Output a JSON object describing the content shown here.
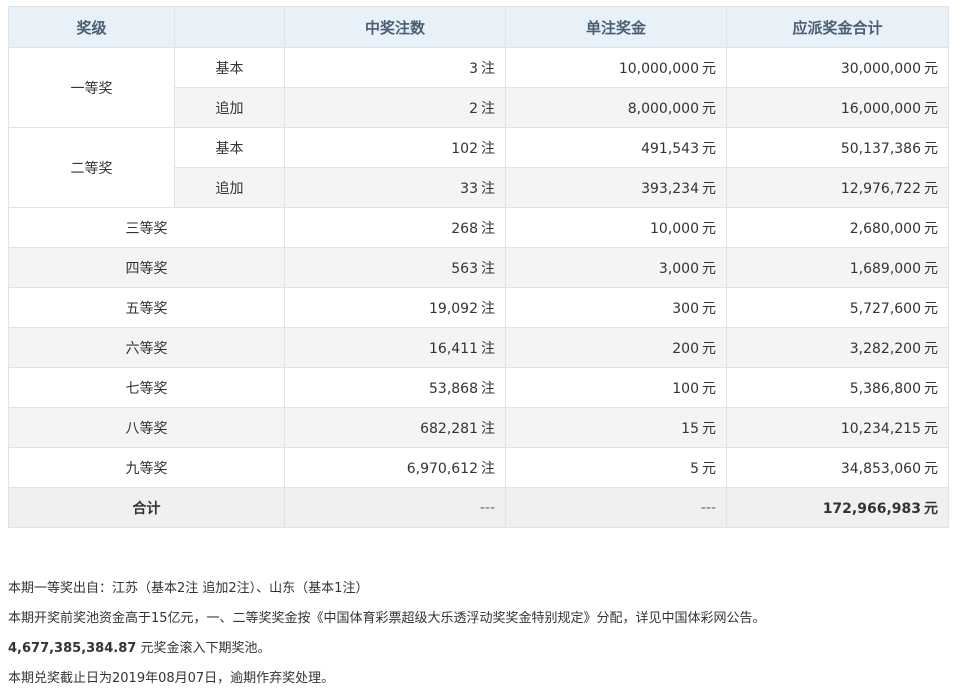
{
  "header": {
    "level": "奖级",
    "count": "中奖注数",
    "unit_prize": "单注奖金",
    "total": "应派奖金合计"
  },
  "units": {
    "zhu": "注",
    "yuan": "元"
  },
  "first": {
    "label": "一等奖",
    "basic": {
      "sub": "基本",
      "count": "3",
      "unit_prize": "10,000,000",
      "total": "30,000,000"
    },
    "extra": {
      "sub": "追加",
      "count": "2",
      "unit_prize": "8,000,000",
      "total": "16,000,000"
    }
  },
  "second": {
    "label": "二等奖",
    "basic": {
      "sub": "基本",
      "count": "102",
      "unit_prize": "491,543",
      "total": "50,137,386"
    },
    "extra": {
      "sub": "追加",
      "count": "33",
      "unit_prize": "393,234",
      "total": "12,976,722"
    }
  },
  "rows": [
    {
      "label": "三等奖",
      "count": "268",
      "unit_prize": "10,000",
      "total": "2,680,000"
    },
    {
      "label": "四等奖",
      "count": "563",
      "unit_prize": "3,000",
      "total": "1,689,000"
    },
    {
      "label": "五等奖",
      "count": "19,092",
      "unit_prize": "300",
      "total": "5,727,600"
    },
    {
      "label": "六等奖",
      "count": "16,411",
      "unit_prize": "200",
      "total": "3,282,200"
    },
    {
      "label": "七等奖",
      "count": "53,868",
      "unit_prize": "100",
      "total": "5,386,800"
    },
    {
      "label": "八等奖",
      "count": "682,281",
      "unit_prize": "15",
      "total": "10,234,215"
    },
    {
      "label": "九等奖",
      "count": "6,970,612",
      "unit_prize": "5",
      "total": "34,853,060"
    }
  ],
  "sum": {
    "label": "合计",
    "count": "---",
    "unit_prize": "---",
    "total": "172,966,983"
  },
  "notes": {
    "line1": "本期一等奖出自：江苏（基本2注 追加2注）、山东（基本1注）",
    "line2": "本期开奖前奖池资金高于15亿元，一、二等奖奖金按《中国体育彩票超级大乐透浮动奖奖金特别规定》分配，详见中国体彩网公告。",
    "pool_amount": "4,677,385,384.87",
    "line3_rest": " 元奖金滚入下期奖池。",
    "line4": "本期兑奖截止日为2019年08月07日，逾期作弃奖处理。"
  }
}
